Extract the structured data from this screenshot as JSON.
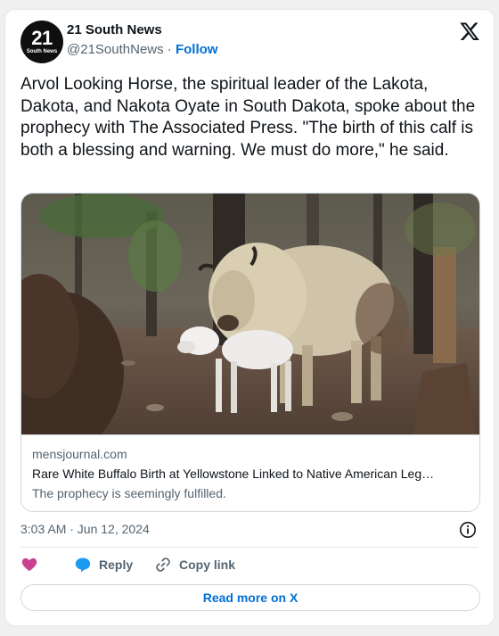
{
  "account": {
    "avatar_number": "21",
    "avatar_subtext": "South News",
    "name": "21 South News",
    "handle": "@21SouthNews",
    "separator": "·",
    "follow_label": "Follow"
  },
  "tweet": {
    "text": "Arvol Looking Horse, the spiritual leader of the Lakota, Dakota, and Nakota Oyate in South Dakota, spoke about the prophecy with The Associated Press. \"The birth of this calf is both a blessing and warning. We must do more,\" he said.",
    "timestamp": "3:03 AM · Jun 12, 2024"
  },
  "link_card": {
    "domain": "mensjournal.com",
    "title": "Rare White Buffalo Birth at Yellowstone Linked to Native American Leg…",
    "description": "The prophecy is seemingly fulfilled."
  },
  "actions": {
    "reply_label": "Reply",
    "copy_link_label": "Copy link",
    "read_more_label": "Read more on X"
  },
  "icons": {
    "brand": "x-logo-icon",
    "info": "info-icon",
    "like": "heart-icon",
    "reply": "reply-bubble-icon",
    "copy": "link-icon"
  },
  "colors": {
    "accent": "#006fd6",
    "heart": "#c9428f",
    "reply_bubble": "#1d9bf0",
    "muted": "#536471"
  }
}
